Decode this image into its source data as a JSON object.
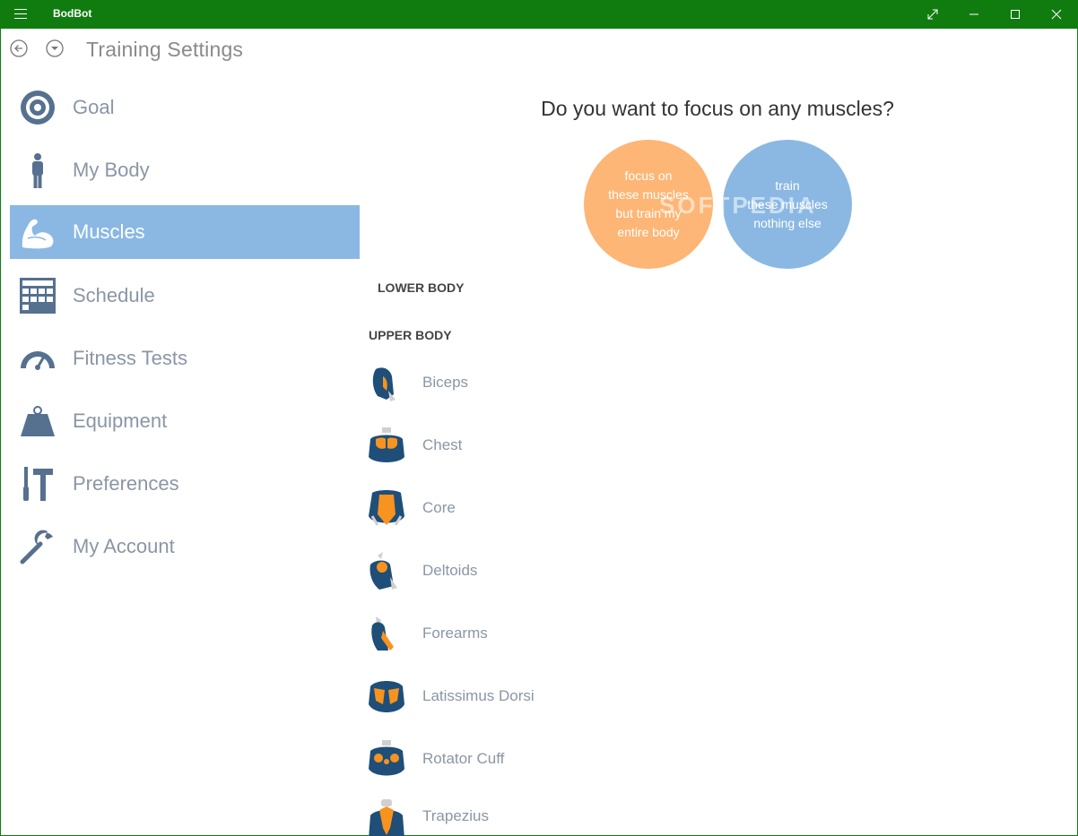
{
  "window": {
    "app_title": "BodBot",
    "title_bar_color": "#107c10"
  },
  "header": {
    "page_title": "Training Settings",
    "back_icon": "back-arrow-icon",
    "dropdown_icon": "chevron-down-circle-icon"
  },
  "sidebar": {
    "items": [
      {
        "label": "Goal",
        "icon": "target-icon",
        "selected": false
      },
      {
        "label": "My Body",
        "icon": "person-icon",
        "selected": false
      },
      {
        "label": "Muscles",
        "icon": "flexed-arm-icon",
        "selected": true
      },
      {
        "label": "Schedule",
        "icon": "calendar-grid-icon",
        "selected": false
      },
      {
        "label": "Fitness Tests",
        "icon": "speedometer-icon",
        "selected": false
      },
      {
        "label": "Equipment",
        "icon": "weight-icon",
        "selected": false
      },
      {
        "label": "Preferences",
        "icon": "tools-icon",
        "selected": false
      },
      {
        "label": "My Account",
        "icon": "wrench-icon",
        "selected": false
      }
    ],
    "selected_color": "#8ab8e3"
  },
  "main": {
    "question": "Do you want to focus on any muscles?",
    "choices": [
      {
        "text": "focus on\nthese muscles\nbut train my\nentire body",
        "color": "#fdb675"
      },
      {
        "text": "train\nthese muscles\nnothing else",
        "color": "#8ab8e3"
      }
    ],
    "watermark": "SOFTPEDIA",
    "lower_body_header": "LOWER BODY",
    "upper_body_header": "UPPER BODY",
    "muscles": [
      {
        "label": "Biceps",
        "icon": "biceps-icon"
      },
      {
        "label": "Chest",
        "icon": "chest-icon"
      },
      {
        "label": "Core",
        "icon": "core-icon"
      },
      {
        "label": "Deltoids",
        "icon": "deltoids-icon"
      },
      {
        "label": "Forearms",
        "icon": "forearms-icon"
      },
      {
        "label": "Latissimus Dorsi",
        "icon": "latissimus-dorsi-icon"
      },
      {
        "label": "Rotator Cuff",
        "icon": "rotator-cuff-icon"
      },
      {
        "label": "Trapezius",
        "icon": "trapezius-icon"
      }
    ],
    "accent_orange": "#f7931e",
    "accent_blue": "#1f4e79"
  }
}
